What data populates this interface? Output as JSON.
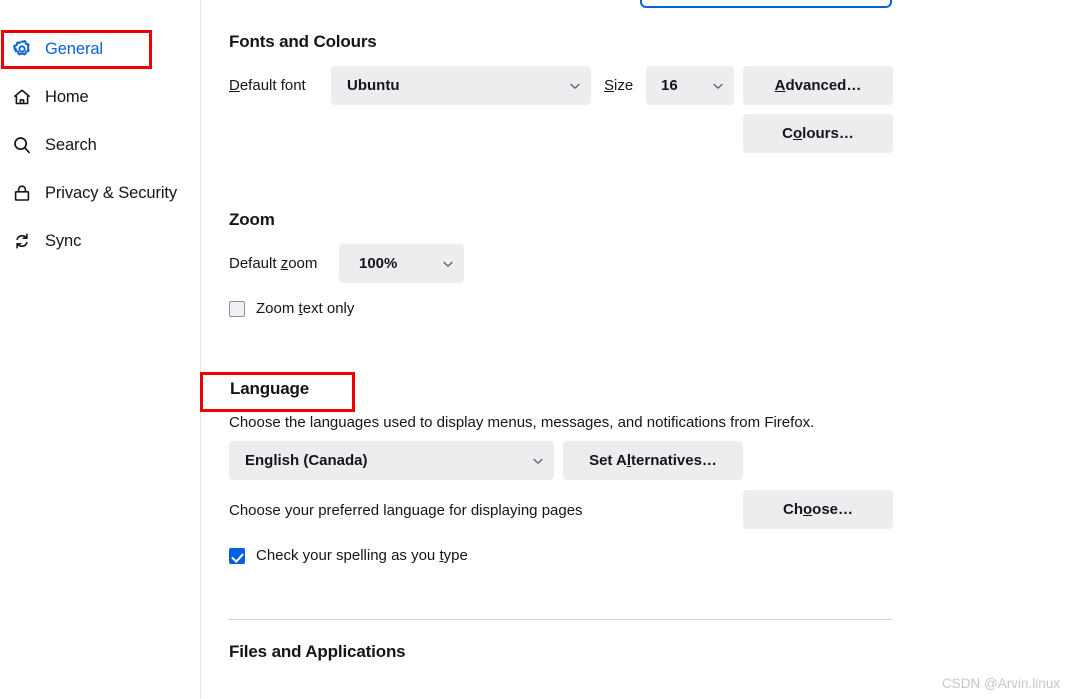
{
  "search": {
    "name": "find-in-settings",
    "value": ""
  },
  "sidebar": {
    "items": [
      {
        "id": "general",
        "label": "General",
        "icon": "gear-icon",
        "selected": true
      },
      {
        "id": "home",
        "label": "Home",
        "icon": "home-icon",
        "selected": false
      },
      {
        "id": "search",
        "label": "Search",
        "icon": "search-icon",
        "selected": false
      },
      {
        "id": "privacy",
        "label": "Privacy & Security",
        "icon": "lock-icon",
        "selected": false
      },
      {
        "id": "sync",
        "label": "Sync",
        "icon": "sync-icon",
        "selected": false
      }
    ]
  },
  "annotations": {
    "color": "#ee0000",
    "boxes": [
      "general-nav-item",
      "language-section-title"
    ]
  },
  "main": {
    "fonts_section": {
      "title": "Fonts and Colours",
      "default_font_label_pre": "D",
      "default_font_label_post": "efault font",
      "default_font_value": "Ubuntu",
      "size_label_pre": "S",
      "size_label_post": "ize",
      "size_value": "16",
      "advanced_button_pre": "A",
      "advanced_button_post": "dvanced…",
      "colours_button_pre": "C",
      "colours_button_key": "o",
      "colours_button_post": "lours…"
    },
    "zoom_section": {
      "title": "Zoom",
      "default_zoom_label_pre": "Default ",
      "default_zoom_label_key": "z",
      "default_zoom_label_post": "oom",
      "default_zoom_value": "100%",
      "zoom_text_only_pre": "Zoom ",
      "zoom_text_only_key": "t",
      "zoom_text_only_post": "ext only",
      "zoom_text_only_checked": false
    },
    "language_section": {
      "title": "Language",
      "description": "Choose the languages used to display menus, messages, and notifications from Firefox.",
      "language_value": "English (Canada)",
      "set_alternatives_pre": "Set A",
      "set_alternatives_key": "l",
      "set_alternatives_post": "ternatives…",
      "preferred_pages_text": "Choose your preferred language for displaying pages",
      "choose_button_pre": "Ch",
      "choose_button_key": "o",
      "choose_button_post": "ose…",
      "spellcheck_pre": "Check your spelling as you ",
      "spellcheck_key": "t",
      "spellcheck_post": "ype",
      "spellcheck_checked": true
    },
    "files_section": {
      "title": "Files and Applications"
    }
  },
  "watermark": {
    "text": "CSDN @Arvin.linux"
  }
}
